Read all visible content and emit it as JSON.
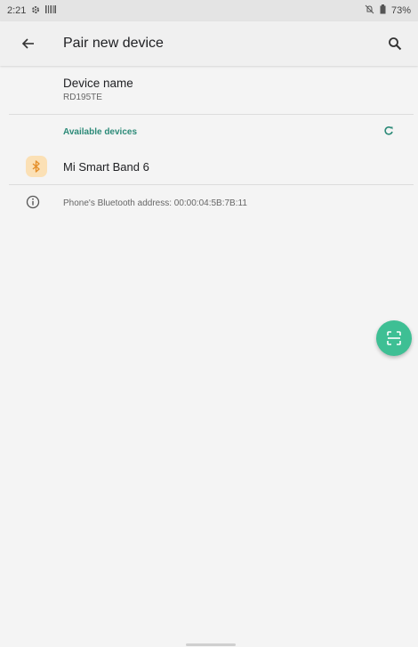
{
  "status_bar": {
    "time": "2:21",
    "battery": "73%",
    "icons": [
      "gear-icon",
      "barcode-icon",
      "silent-icon",
      "battery-icon"
    ]
  },
  "app_bar": {
    "title": "Pair new device",
    "back_icon": "back-arrow-icon",
    "search_icon": "search-icon"
  },
  "device_name": {
    "label": "Device name",
    "value": "RD195TE"
  },
  "available_devices": {
    "header": "Available devices",
    "refresh_icon": "refresh-icon",
    "accent_color": "#2c8a78",
    "items": [
      {
        "label": "Mi Smart Band 6",
        "icon": "bluetooth-icon"
      }
    ]
  },
  "address": {
    "text": "Phone's Bluetooth address: 00:00:04:5B:7B:11",
    "icon": "info-icon"
  },
  "fab": {
    "icon": "qr-scan-icon",
    "color": "#3ebf94"
  }
}
